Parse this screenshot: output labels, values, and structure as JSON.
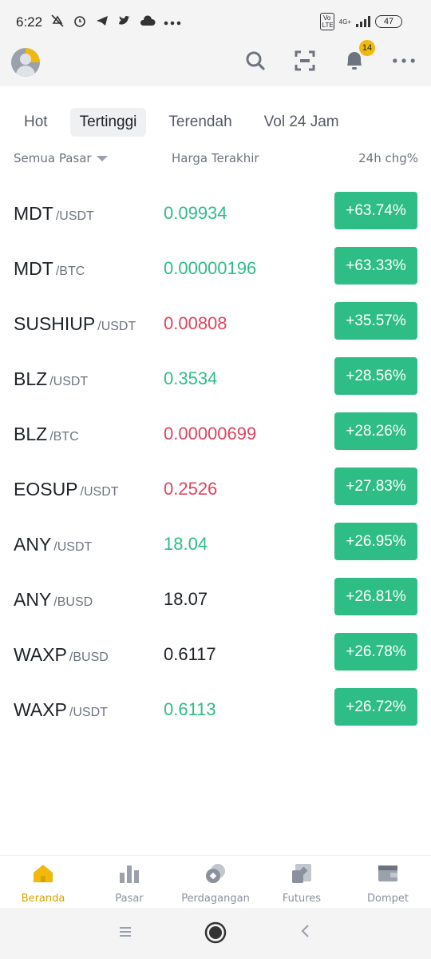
{
  "status_bar": {
    "time": "6:22",
    "icons": [
      "mute-off-icon",
      "alarm-icon",
      "telegram-icon",
      "twitter-icon",
      "cloud-icon",
      "more-dots-icon"
    ],
    "volte_label": "Vo LTE",
    "network_label": "4G+",
    "battery": "47"
  },
  "header": {
    "notification_count": "14"
  },
  "tabs": [
    {
      "label": "Hot",
      "active": false
    },
    {
      "label": "Tertinggi",
      "active": true
    },
    {
      "label": "Terendah",
      "active": false
    },
    {
      "label": "Vol 24 Jam",
      "active": false
    }
  ],
  "columns": {
    "market": "Semua Pasar",
    "price": "Harga Terakhir",
    "change": "24h chg%"
  },
  "rows": [
    {
      "base": "MDT",
      "quote": "/USDT",
      "price": "0.09934",
      "price_color": "green",
      "change": "+63.74%"
    },
    {
      "base": "MDT",
      "quote": "/BTC",
      "price": "0.00000196",
      "price_color": "green",
      "change": "+63.33%"
    },
    {
      "base": "SUSHIUP",
      "quote": "/USDT",
      "price": "0.00808",
      "price_color": "red",
      "change": "+35.57%"
    },
    {
      "base": "BLZ",
      "quote": "/USDT",
      "price": "0.3534",
      "price_color": "green",
      "change": "+28.56%"
    },
    {
      "base": "BLZ",
      "quote": "/BTC",
      "price": "0.00000699",
      "price_color": "red",
      "change": "+28.26%"
    },
    {
      "base": "EOSUP",
      "quote": "/USDT",
      "price": "0.2526",
      "price_color": "red",
      "change": "+27.83%"
    },
    {
      "base": "ANY",
      "quote": "/USDT",
      "price": "18.04",
      "price_color": "green",
      "change": "+26.95%"
    },
    {
      "base": "ANY",
      "quote": "/BUSD",
      "price": "18.07",
      "price_color": "neutral",
      "change": "+26.81%"
    },
    {
      "base": "WAXP",
      "quote": "/BUSD",
      "price": "0.6117",
      "price_color": "neutral",
      "change": "+26.78%"
    },
    {
      "base": "WAXP",
      "quote": "/USDT",
      "price": "0.6113",
      "price_color": "green",
      "change": "+26.72%"
    }
  ],
  "bottom_nav": [
    {
      "label": "Beranda",
      "icon": "home-icon",
      "active": true
    },
    {
      "label": "Pasar",
      "icon": "market-bars-icon",
      "active": false
    },
    {
      "label": "Perdagangan",
      "icon": "trade-coins-icon",
      "active": false
    },
    {
      "label": "Futures",
      "icon": "futures-icon",
      "active": false
    },
    {
      "label": "Dompet",
      "icon": "wallet-icon",
      "active": false
    }
  ],
  "colors": {
    "accent": "#f0b90b",
    "up": "#2ebd85",
    "down": "#e0445d",
    "text": "#1e2329",
    "muted": "#8a919d"
  }
}
